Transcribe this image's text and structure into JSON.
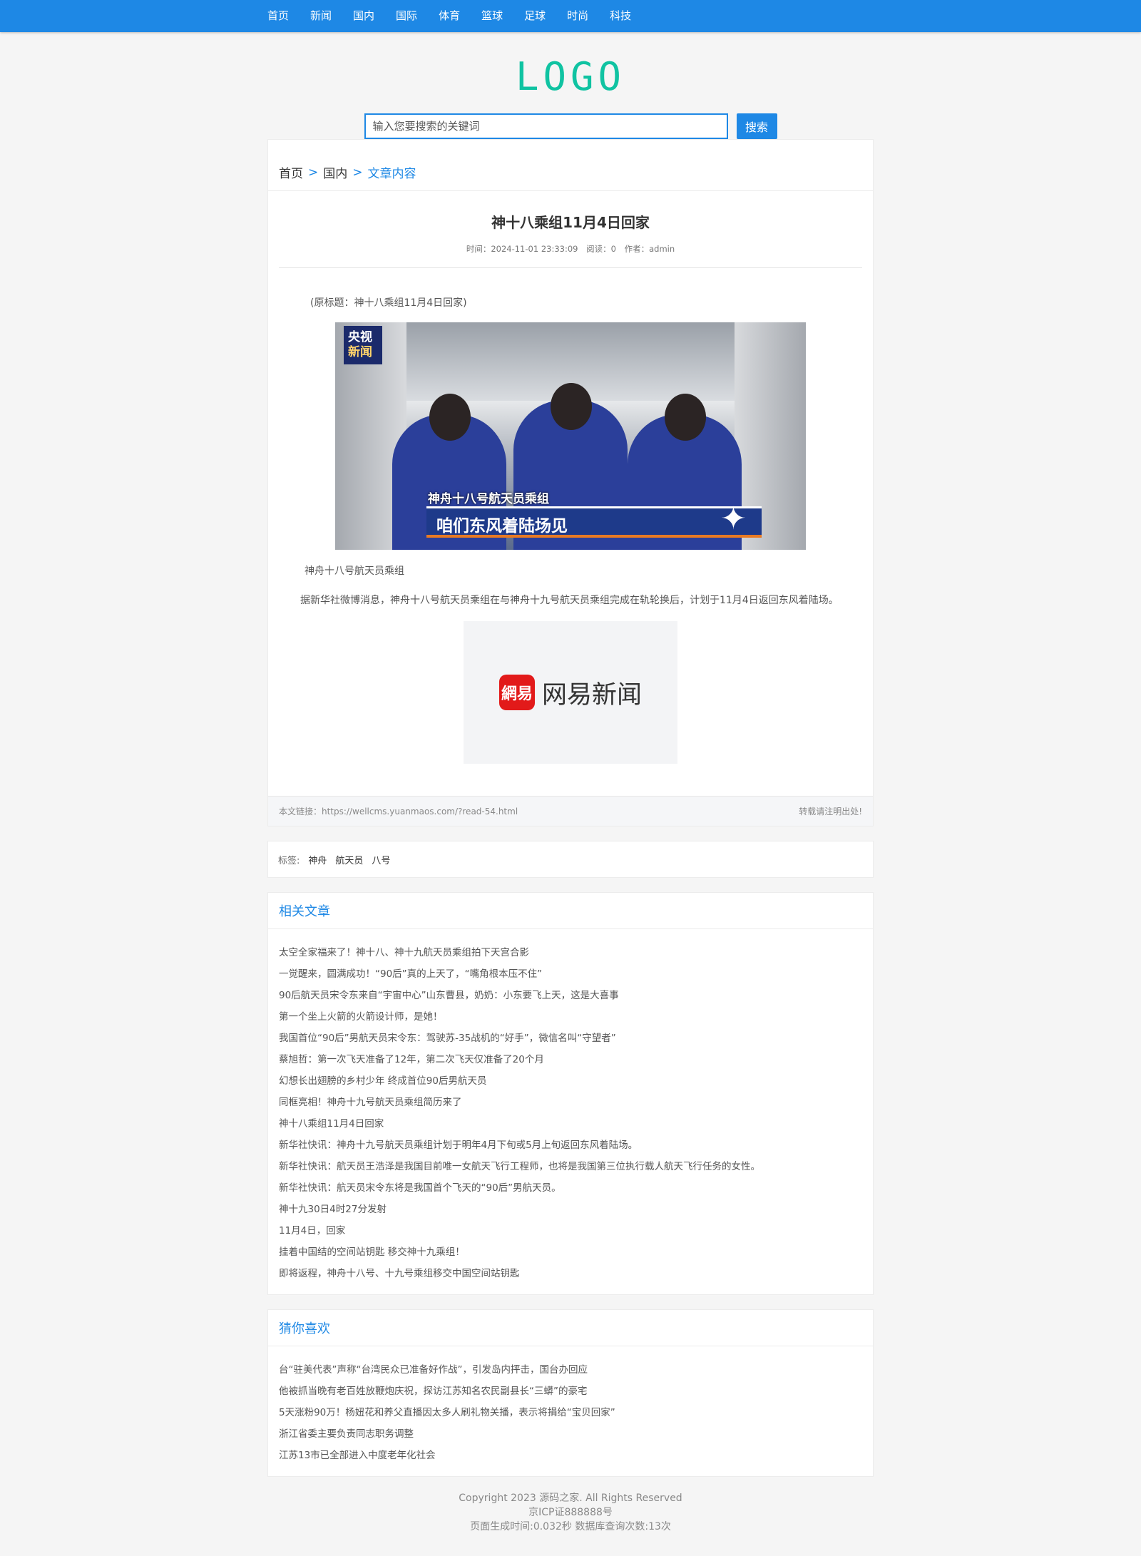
{
  "nav": {
    "items": [
      "首页",
      "新闻",
      "国内",
      "国际",
      "体育",
      "篮球",
      "足球",
      "时尚",
      "科技"
    ]
  },
  "logo": {
    "text": "LOGO",
    "color": "#10c3a2"
  },
  "search": {
    "placeholder": "输入您要搜索的关键词",
    "button_label": "搜索"
  },
  "breadcrumb": {
    "home": "首页",
    "sep1": ">",
    "category": "国内",
    "sep2": ">",
    "current": "文章内容"
  },
  "article": {
    "title": "神十八乘组11月4日回家",
    "meta_time": "时间：2024-11-01 23:33:09",
    "meta_reads": "阅读：0",
    "meta_author": "作者：admin",
    "orig_title": "(原标题：神十八乘组11月4日回家)",
    "image1": {
      "badge_line1": "央视",
      "badge_line2": "新闻",
      "caption_small": "神舟十八号航天员乘组",
      "caption_big": "咱们东风着陆场见"
    },
    "caption": "神舟十八号航天员乘组",
    "paragraph": "据新华社微博消息，神舟十八号航天员乘组在与神舟十九号航天员乘组完成在轨轮换后，计划于11月4日返回东风着陆场。",
    "image2": {
      "logo_text": "網易",
      "brand_text": "网易新闻"
    },
    "link_text": "本文链接：https://wellcms.yuanmaos.com/?read-54.html",
    "reprint_note": "转载请注明出处!"
  },
  "tags": {
    "label": "标签:",
    "items": [
      "神舟",
      "航天员",
      "八号"
    ]
  },
  "related": {
    "title": "相关文章",
    "items": [
      "太空全家福来了！神十八、神十九航天员乘组拍下天宫合影",
      "一觉醒来，圆满成功！“90后”真的上天了，“嘴角根本压不住”",
      "90后航天员宋令东来自“宇宙中心”山东曹县，奶奶：小东要飞上天，这是大喜事",
      "第一个坐上火箭的火箭设计师，是她！",
      "我国首位“90后”男航天员宋令东：驾驶苏-35战机的“好手”，微信名叫“守望者”",
      "蔡旭哲：第一次飞天准备了12年，第二次飞天仅准备了20个月",
      "幻想长出翅膀的乡村少年 终成首位90后男航天员",
      "同框亮相！神舟十九号航天员乘组简历来了",
      "神十八乘组11月4日回家",
      "新华社快讯：神舟十九号航天员乘组计划于明年4月下旬或5月上旬返回东风着陆场。",
      "新华社快讯：航天员王浩泽是我国目前唯一女航天飞行工程师，也将是我国第三位执行载人航天飞行任务的女性。",
      "新华社快讯：航天员宋令东将是我国首个飞天的“90后”男航天员。",
      "神十九30日4时27分发射",
      "11月4日，回家",
      "挂着中国结的空间站钥匙 移交神十九乘组！",
      "即将返程，神舟十八号、十九号乘组移交中国空间站钥匙"
    ]
  },
  "guess": {
    "title": "猜你喜欢",
    "items": [
      "台“驻美代表”声称“台湾民众已准备好作战”，引发岛内抨击，国台办回应",
      "他被抓当晚有老百姓放鞭炮庆祝，探访江苏知名农民副县长“三蟒”的豪宅",
      "5天涨粉90万！杨妞花和养父直播因太多人刷礼物关播，表示将捐给“宝贝回家”",
      "浙江省委主要负责同志职务调整",
      "江苏13市已全部进入中度老年化社会"
    ]
  },
  "footer": {
    "copyright": "Copyright 2023 源码之家. All Rights Reserved",
    "icp": "京ICP证888888号",
    "stats": "页面生成时间:0.032秒   数据库查询次数:13次"
  }
}
